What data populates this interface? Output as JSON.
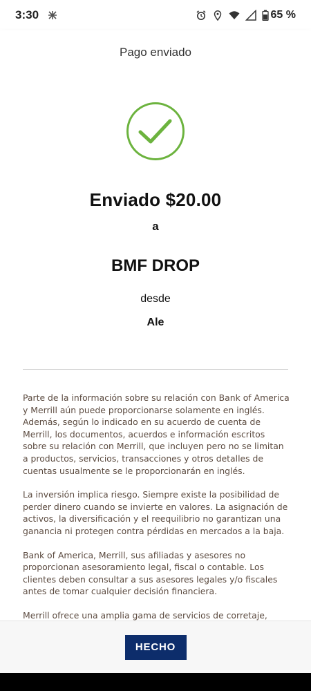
{
  "status_bar": {
    "time": "3:30",
    "battery_text": "65 %",
    "icons": [
      "notification-icon",
      "alarm-icon",
      "location-icon",
      "wifi-icon",
      "signal-icon",
      "battery-icon"
    ]
  },
  "header": {
    "title": "Pago enviado"
  },
  "confirmation": {
    "icon": "check-circle-icon",
    "accent_color": "#6cb33e",
    "sent_line": "Enviado $20.00",
    "to_word": "a",
    "recipient": "BMF DROP",
    "from_word": "desde",
    "sender": "Ale"
  },
  "disclaimers": [
    "Parte de la información sobre su relación con Bank of America y Merrill aún puede proporcionarse solamente en inglés. Además, según lo indicado en su acuerdo de cuenta de Merrill, los documentos, acuerdos e información escritos sobre su relación con Merrill, que incluyen pero no se limitan a productos, servicios, transacciones y otros detalles de cuentas usualmente se le proporcionarán en inglés.",
    "La inversión implica riesgo. Siempre existe la posibilidad de perder dinero cuando se invierte en valores. La asignación de activos, la diversificación y el reequilibrio no garantizan una ganancia ni protegen contra pérdidas en mercados a la baja.",
    "Bank of America, Merrill, sus afiliadas y asesores no proporcionan asesoramiento legal, fiscal o contable. Los clientes deben consultar a sus asesores legales y/o fiscales antes de tomar cualquier decisión financiera.",
    "Merrill ofrece una amplia gama de servicios de corretaje, asesoramiento de inversiones (incluido la planificación"
  ],
  "footer": {
    "done_label": "HECHO",
    "button_color": "#0d2d6b"
  }
}
